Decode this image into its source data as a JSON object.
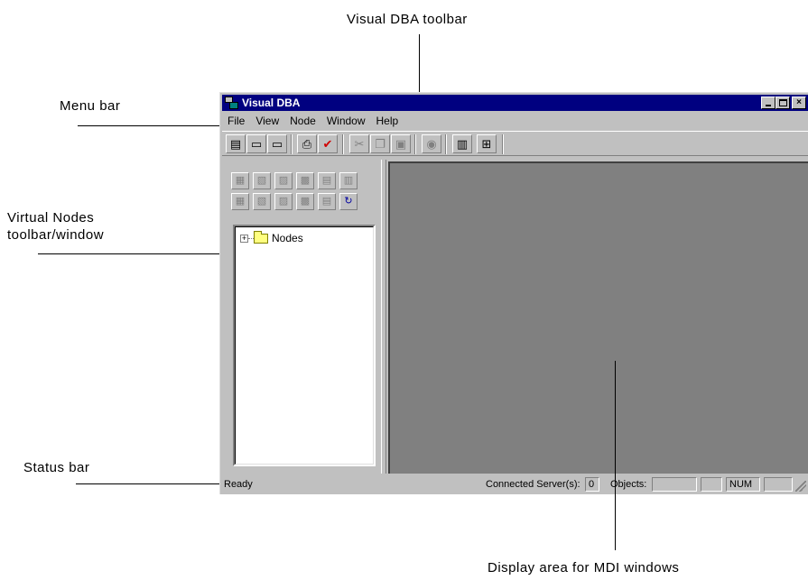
{
  "annotations": {
    "visual_dba_toolbar": "Visual DBA toolbar",
    "menu_bar": "Menu bar",
    "virtual_nodes_line1": "Virtual Nodes",
    "virtual_nodes_line2": "toolbar/window",
    "status_bar": "Status bar",
    "display_area": "Display area for MDI windows"
  },
  "window": {
    "title": "Visual DBA",
    "menu": [
      "File",
      "View",
      "Node",
      "Window",
      "Help"
    ],
    "toolbar_icons": [
      "new-icon",
      "open-icon",
      "save-icon",
      "print-icon",
      "check-icon",
      "cut-icon",
      "copy-icon",
      "paste-icon",
      "find-icon",
      "window-icon",
      "tile-icon"
    ],
    "vnode_toolbar_icons": [
      "add-node-icon",
      "alter-node-icon",
      "drop-node-icon",
      "connect-icon",
      "sql-icon",
      "monitor-icon",
      "ipm-icon",
      "dom-icon",
      "query-icon",
      "refresh-node-icon",
      "force-refresh-icon",
      "refresh-icon"
    ],
    "tree": {
      "root_label": "Nodes"
    },
    "status": {
      "ready": "Ready",
      "connected_label": "Connected Server(s):",
      "connected_value": "0",
      "objects_label": "Objects:",
      "objects_value": "",
      "num": "NUM"
    }
  },
  "colors": {
    "titlebar": "#000080",
    "chrome": "#c0c0c0",
    "display_area": "#808080"
  }
}
